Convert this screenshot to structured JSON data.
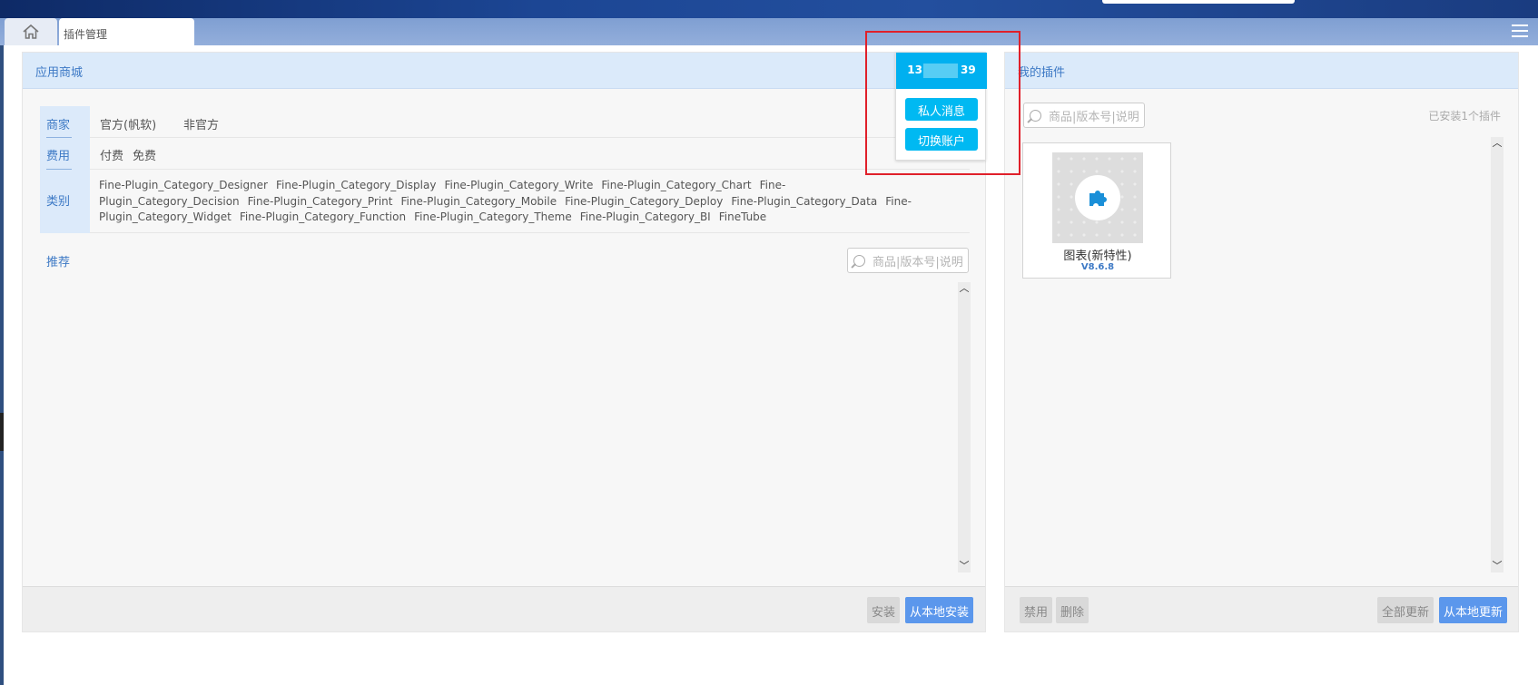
{
  "tabs": {
    "home_icon": "home-icon",
    "active_tab": "插件管理",
    "menu_icon": "hamburger-menu-icon"
  },
  "store": {
    "title": "应用商城",
    "filters": {
      "vendor_label": "商家",
      "vendor_options": [
        "官方(帆软)",
        "非官方"
      ],
      "fee_label": "费用",
      "fee_options": [
        "付费",
        "免费"
      ],
      "category_label": "类别",
      "categories": [
        "Fine-Plugin_Category_Designer",
        "Fine-Plugin_Category_Display",
        "Fine-Plugin_Category_Write",
        "Fine-Plugin_Category_Chart",
        "Fine-Plugin_Category_Decision",
        "Fine-Plugin_Category_Print",
        "Fine-Plugin_Category_Mobile",
        "Fine-Plugin_Category_Deploy",
        "Fine-Plugin_Category_Data",
        "Fine-Plugin_Category_Widget",
        "Fine-Plugin_Category_Function",
        "Fine-Plugin_Category_Theme",
        "Fine-Plugin_Category_BI",
        "FineTube"
      ]
    },
    "recommend_label": "推荐",
    "search_placeholder": "商品|版本号|说明",
    "install_button": "安装",
    "install_local_button": "从本地安装"
  },
  "my_plugins": {
    "title": "我的插件",
    "search_placeholder": "商品|版本号|说明",
    "installed_count": "已安装1个插件",
    "plugins": [
      {
        "name": "图表(新特性)",
        "version": "V8.6.8",
        "icon": "puzzle-piece-icon"
      }
    ],
    "disable_button": "禁用",
    "delete_button": "删除",
    "update_all_button": "全部更新",
    "update_local_button": "从本地更新"
  },
  "user_popup": {
    "user_id_start": "13",
    "user_id_end": "39",
    "messages_button": "私人消息",
    "switch_account_button": "切换账户"
  },
  "colors": {
    "accent_blue": "#5b97ec",
    "popup_cyan": "#00b0f0",
    "highlight_red": "#e0202a",
    "header_bg": "#dbeafa"
  }
}
